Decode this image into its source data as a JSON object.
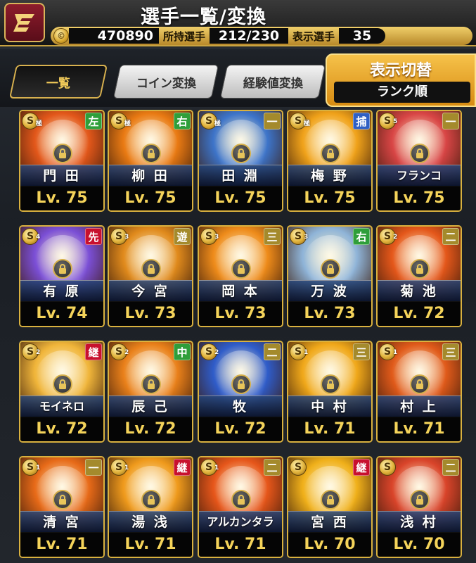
{
  "header": {
    "title": "選手一覧/変換",
    "coin_icon_text": "©",
    "coins": "470890",
    "owned_label": "所持選手",
    "owned_value": "212/230",
    "shown_label": "表示選手",
    "shown_value": "35",
    "logo_icon": "team-logo-icon"
  },
  "tabs": [
    {
      "label": "一覧",
      "active": true
    },
    {
      "label": "コイン変換",
      "active": false
    },
    {
      "label": "経験値変換",
      "active": false
    }
  ],
  "sort": {
    "title": "表示切替",
    "value": "ランク順"
  },
  "colors": {
    "gold": "#d9b13f",
    "badge_red": "#c8102e",
    "badge_green": "#2f9e3a",
    "badge_blue": "#2f5fc4",
    "badge_olive": "#a48a2c",
    "level_text": "#f4d35a"
  },
  "cards": [
    {
      "name": "門 田",
      "level": "Lv. 75",
      "pos": "左",
      "pos_color": "#2f9e3a",
      "rank": "S",
      "rank_sub": "極",
      "art": "#e2571a"
    },
    {
      "name": "柳 田",
      "level": "Lv. 75",
      "pos": "右",
      "pos_color": "#2f9e3a",
      "rank": "S",
      "rank_sub": "極",
      "art": "#e97a13"
    },
    {
      "name": "田 淵",
      "level": "Lv. 75",
      "pos": "一",
      "pos_color": "#a48a2c",
      "rank": "S",
      "rank_sub": "極",
      "art": "#3d74c9"
    },
    {
      "name": "梅 野",
      "level": "Lv. 75",
      "pos": "捕",
      "pos_color": "#2f5fc4",
      "rank": "S",
      "rank_sub": "極",
      "art": "#f0a21a"
    },
    {
      "name": "フランコ",
      "level": "Lv. 75",
      "pos": "一",
      "pos_color": "#a48a2c",
      "rank": "S",
      "rank_sub": "5",
      "art": "#d84545"
    },
    {
      "name": "有 原",
      "level": "Lv. 74",
      "pos": "先",
      "pos_color": "#c8102e",
      "rank": "S",
      "rank_sub": "4",
      "art": "#7b4fd6"
    },
    {
      "name": "今 宮",
      "level": "Lv. 73",
      "pos": "遊",
      "pos_color": "#a48a2c",
      "rank": "S",
      "rank_sub": "3",
      "art": "#e08a1c"
    },
    {
      "name": "岡 本",
      "level": "Lv. 73",
      "pos": "三",
      "pos_color": "#a48a2c",
      "rank": "S",
      "rank_sub": "3",
      "art": "#ee8b1a"
    },
    {
      "name": "万 波",
      "level": "Lv. 73",
      "pos": "右",
      "pos_color": "#2f9e3a",
      "rank": "S",
      "rank_sub": "3",
      "art": "#8fb4d8"
    },
    {
      "name": "菊 池",
      "level": "Lv. 72",
      "pos": "二",
      "pos_color": "#a48a2c",
      "rank": "S",
      "rank_sub": "2",
      "art": "#e4571a"
    },
    {
      "name": "モイネロ",
      "level": "Lv. 72",
      "pos": "継",
      "pos_color": "#c8102e",
      "rank": "S",
      "rank_sub": "2",
      "art": "#f0b53a"
    },
    {
      "name": "辰 己",
      "level": "Lv. 72",
      "pos": "中",
      "pos_color": "#2f9e3a",
      "rank": "S",
      "rank_sub": "2",
      "art": "#e9801a"
    },
    {
      "name": "牧",
      "level": "Lv. 72",
      "pos": "二",
      "pos_color": "#a48a2c",
      "rank": "S",
      "rank_sub": "2",
      "art": "#2f5cc9"
    },
    {
      "name": "中 村",
      "level": "Lv. 71",
      "pos": "三",
      "pos_color": "#a48a2c",
      "rank": "S",
      "rank_sub": "1",
      "art": "#f0a81a"
    },
    {
      "name": "村 上",
      "level": "Lv. 71",
      "pos": "三",
      "pos_color": "#a48a2c",
      "rank": "S",
      "rank_sub": "1",
      "art": "#e05a1a"
    },
    {
      "name": "清 宮",
      "level": "Lv. 71",
      "pos": "一",
      "pos_color": "#a48a2c",
      "rank": "S",
      "rank_sub": "1",
      "art": "#e76a18"
    },
    {
      "name": "湯 浅",
      "level": "Lv. 71",
      "pos": "継",
      "pos_color": "#c8102e",
      "rank": "S",
      "rank_sub": "1",
      "art": "#ef9a1c"
    },
    {
      "name": "アルカンタラ",
      "level": "Lv. 71",
      "pos": "二",
      "pos_color": "#a48a2c",
      "rank": "S",
      "rank_sub": "1",
      "art": "#e6561a"
    },
    {
      "name": "宮 西",
      "level": "Lv. 70",
      "pos": "継",
      "pos_color": "#c8102e",
      "rank": "S",
      "rank_sub": "",
      "art": "#f0b01a"
    },
    {
      "name": "浅 村",
      "level": "Lv. 70",
      "pos": "二",
      "pos_color": "#a48a2c",
      "rank": "S",
      "rank_sub": "",
      "art": "#d9442a"
    }
  ]
}
